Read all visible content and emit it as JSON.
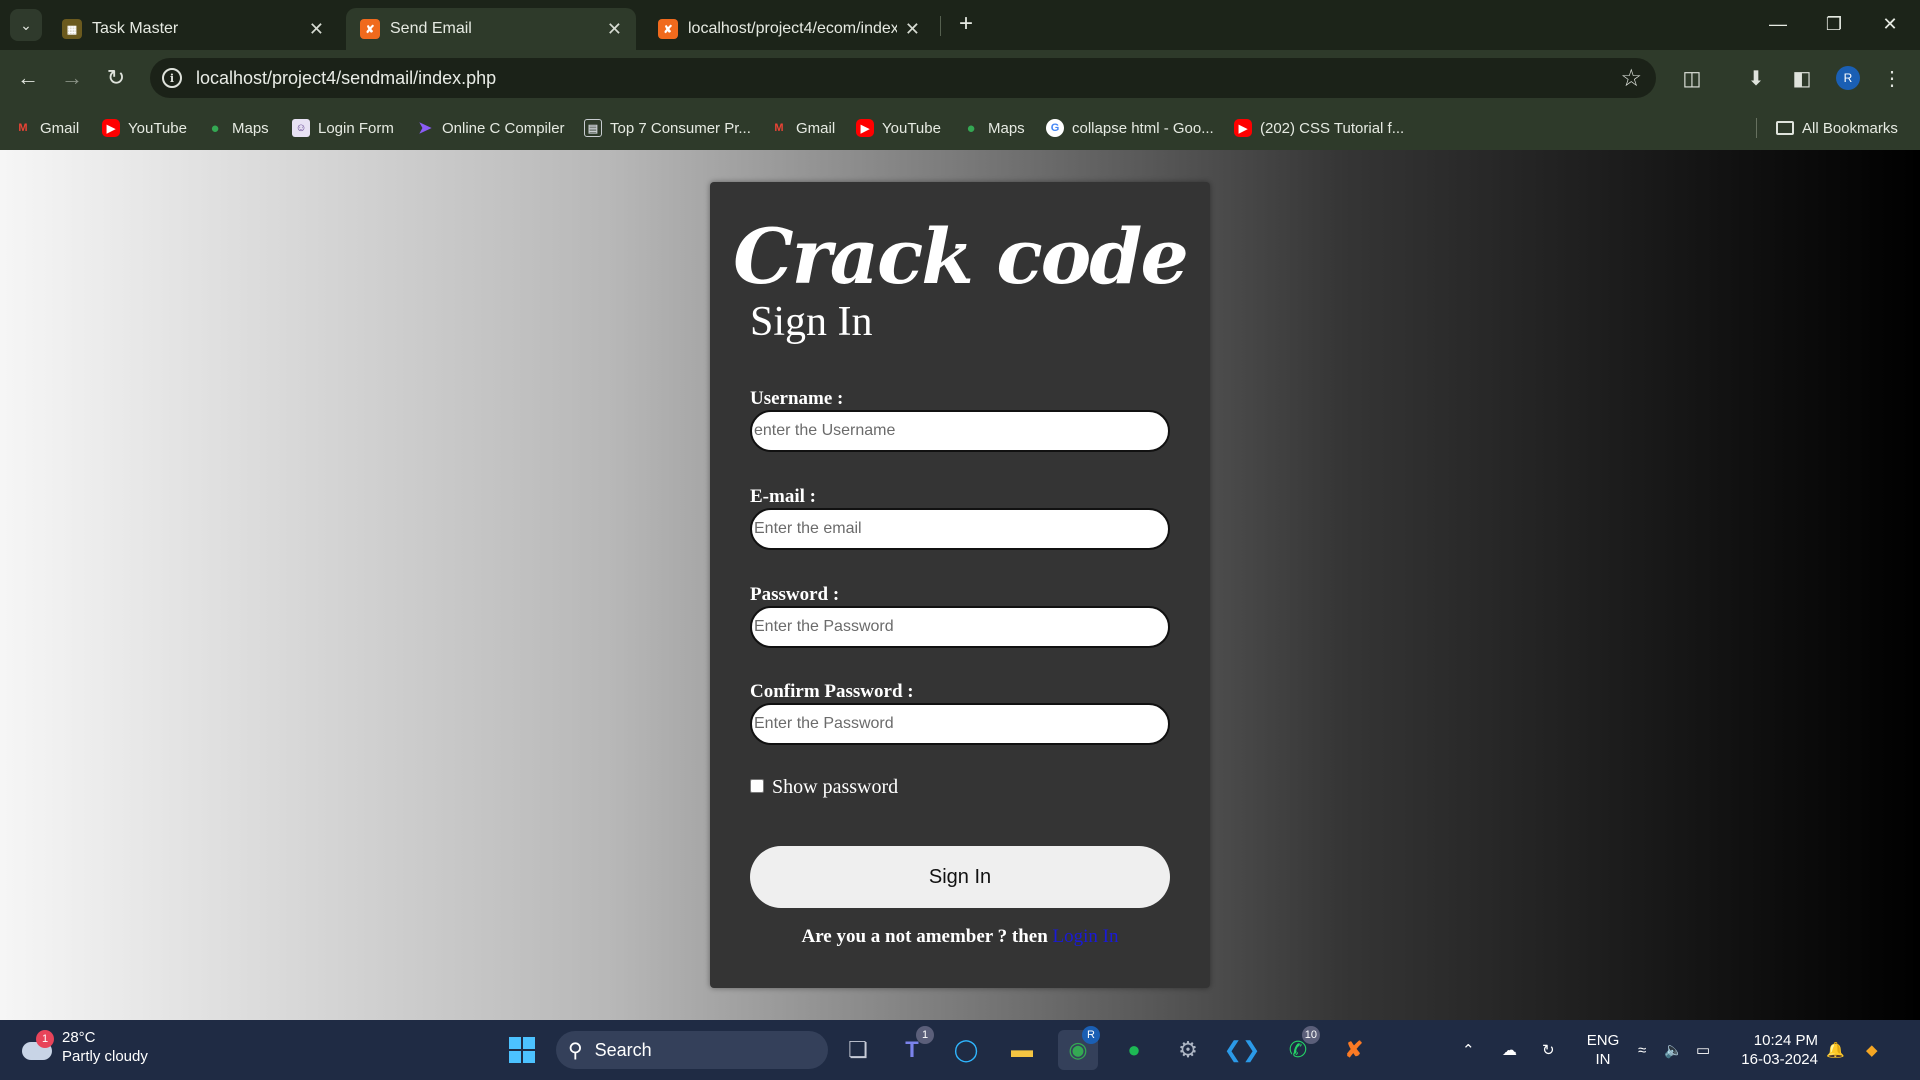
{
  "browser": {
    "tabs": [
      {
        "title": "Task Master",
        "icon": "task-master-favicon"
      },
      {
        "title": "Send Email",
        "icon": "xampp-favicon"
      },
      {
        "title": "localhost/project4/ecom/index.",
        "icon": "xampp-favicon"
      }
    ],
    "url": "localhost/project4/sendmail/index.php",
    "bookmarks": [
      {
        "label": "Gmail",
        "icon": "gmail-icon"
      },
      {
        "label": "YouTube",
        "icon": "youtube-icon"
      },
      {
        "label": "Maps",
        "icon": "maps-icon"
      },
      {
        "label": "Login Form",
        "icon": "login-form-icon"
      },
      {
        "label": "Online C Compiler",
        "icon": "compiler-icon"
      },
      {
        "label": "Top 7 Consumer Pr...",
        "icon": "article-icon"
      },
      {
        "label": "Gmail",
        "icon": "gmail-icon"
      },
      {
        "label": "YouTube",
        "icon": "youtube-icon"
      },
      {
        "label": "Maps",
        "icon": "maps-icon"
      },
      {
        "label": "collapse html - Goo...",
        "icon": "google-icon"
      },
      {
        "label": "(202) CSS Tutorial f...",
        "icon": "youtube-icon"
      }
    ],
    "all_bookmarks": "All Bookmarks",
    "profile_initial": "R"
  },
  "page": {
    "brand": "Crack code",
    "heading": "Sign In",
    "username": {
      "label": "Username :",
      "placeholder": "enter the Username"
    },
    "email": {
      "label": "E-mail :",
      "placeholder": "Enter the email"
    },
    "password": {
      "label": "Password :",
      "placeholder": "Enter the Password"
    },
    "confirm": {
      "label": "Confirm Password :",
      "placeholder": "Enter the Password"
    },
    "show_password": "Show password",
    "submit": "Sign In",
    "footer_text": "Are you a not amember ? then",
    "footer_link": "Login In"
  },
  "taskbar": {
    "weather_badge": "1",
    "temperature": "28°C",
    "condition": "Partly cloudy",
    "search": "Search",
    "teams_badge": "1",
    "whatsapp_badge": "10",
    "chrome_profile": "R",
    "lang_top": "ENG",
    "lang_bottom": "IN",
    "time": "10:24 PM",
    "date": "16-03-2024"
  },
  "colors": {
    "chrome_bg": "#2e3a2a",
    "card_bg": "#343434",
    "link": "#1a1ad6",
    "taskbar_bg": "#1f2b44"
  }
}
